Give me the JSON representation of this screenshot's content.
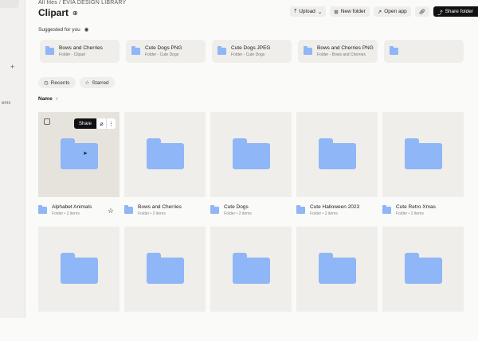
{
  "sidebar": {
    "plus": "+",
    "fragment": "ems"
  },
  "breadcrumb": "All files / EVIA DESIGN LIBRARY",
  "title": "Clipart",
  "toolbar": {
    "upload": "Upload",
    "new_folder": "New folder",
    "open_app": "Open app",
    "share_folder": "Share folder"
  },
  "suggested": {
    "heading": "Suggested for you",
    "items": [
      {
        "title": "Bows and Cherries",
        "sub": "Folder - Clipart"
      },
      {
        "title": "Cute Dogs PNG",
        "sub": "Folder - Cute Dogs"
      },
      {
        "title": "Cute Dogs JPEG",
        "sub": "Folder - Cute Dogs"
      },
      {
        "title": "Bows and Cherries PNG",
        "sub": "Folder - Bows and Cherries"
      },
      {
        "title": "",
        "sub": ""
      }
    ]
  },
  "chips": {
    "recents": "Recents",
    "starred": "Starred"
  },
  "sort": {
    "label": "Name",
    "arrow": "↑"
  },
  "hover": {
    "share": "Share"
  },
  "folders": [
    {
      "name": "Alphabet Animals",
      "sub": "Folder • 2 items"
    },
    {
      "name": "Bows and Cherries",
      "sub": "Folder • 2 items"
    },
    {
      "name": "Cute Dogs",
      "sub": "Folder • 2 items"
    },
    {
      "name": "Cute Halloween 2023",
      "sub": "Folder • 2 items"
    },
    {
      "name": "Cute Retro Xmas",
      "sub": "Folder • 2 items"
    }
  ],
  "colors": {
    "folder": "#8fb6f7",
    "accent": "#111111"
  }
}
